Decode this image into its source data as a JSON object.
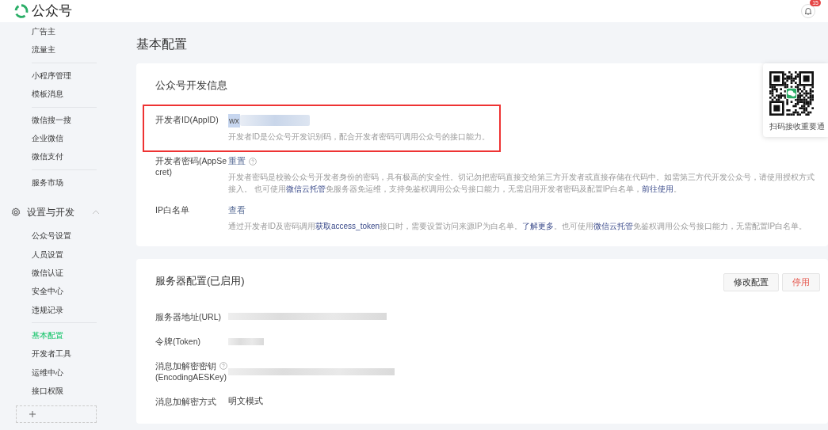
{
  "header": {
    "title": "公众号",
    "notifications": "15"
  },
  "sidebar": {
    "items": [
      {
        "kind": "item",
        "label": "广告主",
        "selected": false
      },
      {
        "kind": "item",
        "label": "流量主",
        "selected": false
      },
      {
        "kind": "divider"
      },
      {
        "kind": "item",
        "label": "小程序管理",
        "selected": false
      },
      {
        "kind": "item",
        "label": "模板消息",
        "selected": false
      },
      {
        "kind": "divider"
      },
      {
        "kind": "item",
        "label": "微信搜一搜",
        "selected": false
      },
      {
        "kind": "item",
        "label": "企业微信",
        "selected": false
      },
      {
        "kind": "item",
        "label": "微信支付",
        "selected": false
      },
      {
        "kind": "divider"
      },
      {
        "kind": "item",
        "label": "服务市场",
        "selected": false
      },
      {
        "kind": "section",
        "label": "设置与开发",
        "expanded": true
      },
      {
        "kind": "item",
        "label": "公众号设置",
        "selected": false
      },
      {
        "kind": "item",
        "label": "人员设置",
        "selected": false
      },
      {
        "kind": "item",
        "label": "微信认证",
        "selected": false
      },
      {
        "kind": "item",
        "label": "安全中心",
        "selected": false
      },
      {
        "kind": "item",
        "label": "违规记录",
        "selected": false
      },
      {
        "kind": "divider"
      },
      {
        "kind": "item",
        "label": "基本配置",
        "selected": true
      },
      {
        "kind": "item",
        "label": "开发者工具",
        "selected": false
      },
      {
        "kind": "item",
        "label": "运维中心",
        "selected": false
      },
      {
        "kind": "item",
        "label": "接口权限",
        "selected": false
      },
      {
        "kind": "add"
      }
    ]
  },
  "page_title": "基本配置",
  "dev_info": {
    "title": "公众号开发信息",
    "rows": [
      {
        "label": "开发者ID(AppID)",
        "value": "wx",
        "redacted": true,
        "highlighted": true,
        "help_icon": false,
        "help": [
          {
            "text": "开发者ID是公众号开发识别码，配合开发者密码可调用公众号的接口能力。",
            "link": false
          }
        ]
      },
      {
        "label": "开发者密码(AppSecret)",
        "action": "重置",
        "redacted": false,
        "highlighted": false,
        "help_icon": true,
        "help": [
          {
            "text": "开发者密码是校验公众号开发者身份的密码，具有极高的安全性。切记勿把密码直接交给第三方开发者或直接存储在代码中。如需第三方代开发公众号，请使用授权方式接入。 也可使用",
            "link": false
          },
          {
            "text": "微信云托管",
            "link": true
          },
          {
            "text": "免服务器免运维，支持免鉴权调用公众号接口能力，无需启用开发者密码及配置IP白名单，",
            "link": false
          },
          {
            "text": "前往使用",
            "link": true
          },
          {
            "text": "。",
            "link": false
          }
        ]
      },
      {
        "label": "IP白名单",
        "action": "查看",
        "redacted": false,
        "highlighted": false,
        "help_icon": false,
        "help": [
          {
            "text": "通过开发者ID及密码调用",
            "link": false
          },
          {
            "text": "获取access_token",
            "link": true
          },
          {
            "text": "接口时，需要设置访问来源IP为白名单。",
            "link": false
          },
          {
            "text": "了解更多",
            "link": true
          },
          {
            "text": "。也可使用",
            "link": false
          },
          {
            "text": "微信云托管",
            "link": true
          },
          {
            "text": "免鉴权调用公众号接口能力，无需配置IP白名单。",
            "link": false
          }
        ]
      }
    ]
  },
  "qr_popup": {
    "caption": "扫码接收重要通"
  },
  "server_config": {
    "title": "服务器配置(已启用)",
    "buttons": [
      {
        "label": "修改配置",
        "kind": "default"
      },
      {
        "label": "停用",
        "kind": "danger"
      }
    ],
    "rows": [
      {
        "label": "服务器地址(URL)",
        "redacted": true,
        "help_icon": false
      },
      {
        "label": "令牌(Token)",
        "redacted": true,
        "help_icon": false
      },
      {
        "label": "消息加解密密钥",
        "sublabel": "(EncodingAESKey)",
        "redacted": true,
        "help_icon": true
      },
      {
        "label": "消息加解密方式",
        "value": "明文模式",
        "redacted": false,
        "help_icon": false
      }
    ]
  }
}
